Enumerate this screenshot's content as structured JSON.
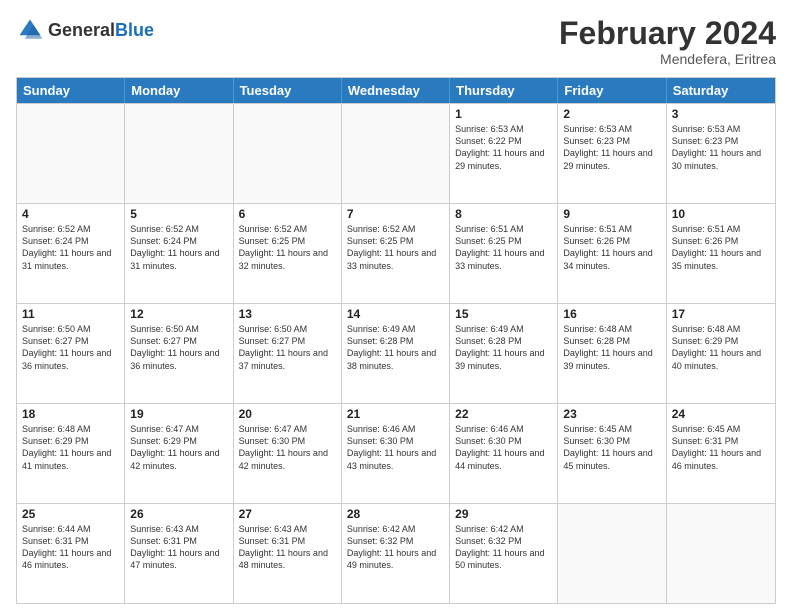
{
  "header": {
    "logo_general": "General",
    "logo_blue": "Blue",
    "month_year": "February 2024",
    "location": "Mendefera, Eritrea"
  },
  "days_of_week": [
    "Sunday",
    "Monday",
    "Tuesday",
    "Wednesday",
    "Thursday",
    "Friday",
    "Saturday"
  ],
  "weeks": [
    [
      {
        "day": "",
        "info": ""
      },
      {
        "day": "",
        "info": ""
      },
      {
        "day": "",
        "info": ""
      },
      {
        "day": "",
        "info": ""
      },
      {
        "day": "1",
        "info": "Sunrise: 6:53 AM\nSunset: 6:22 PM\nDaylight: 11 hours and 29 minutes."
      },
      {
        "day": "2",
        "info": "Sunrise: 6:53 AM\nSunset: 6:23 PM\nDaylight: 11 hours and 29 minutes."
      },
      {
        "day": "3",
        "info": "Sunrise: 6:53 AM\nSunset: 6:23 PM\nDaylight: 11 hours and 30 minutes."
      }
    ],
    [
      {
        "day": "4",
        "info": "Sunrise: 6:52 AM\nSunset: 6:24 PM\nDaylight: 11 hours and 31 minutes."
      },
      {
        "day": "5",
        "info": "Sunrise: 6:52 AM\nSunset: 6:24 PM\nDaylight: 11 hours and 31 minutes."
      },
      {
        "day": "6",
        "info": "Sunrise: 6:52 AM\nSunset: 6:25 PM\nDaylight: 11 hours and 32 minutes."
      },
      {
        "day": "7",
        "info": "Sunrise: 6:52 AM\nSunset: 6:25 PM\nDaylight: 11 hours and 33 minutes."
      },
      {
        "day": "8",
        "info": "Sunrise: 6:51 AM\nSunset: 6:25 PM\nDaylight: 11 hours and 33 minutes."
      },
      {
        "day": "9",
        "info": "Sunrise: 6:51 AM\nSunset: 6:26 PM\nDaylight: 11 hours and 34 minutes."
      },
      {
        "day": "10",
        "info": "Sunrise: 6:51 AM\nSunset: 6:26 PM\nDaylight: 11 hours and 35 minutes."
      }
    ],
    [
      {
        "day": "11",
        "info": "Sunrise: 6:50 AM\nSunset: 6:27 PM\nDaylight: 11 hours and 36 minutes."
      },
      {
        "day": "12",
        "info": "Sunrise: 6:50 AM\nSunset: 6:27 PM\nDaylight: 11 hours and 36 minutes."
      },
      {
        "day": "13",
        "info": "Sunrise: 6:50 AM\nSunset: 6:27 PM\nDaylight: 11 hours and 37 minutes."
      },
      {
        "day": "14",
        "info": "Sunrise: 6:49 AM\nSunset: 6:28 PM\nDaylight: 11 hours and 38 minutes."
      },
      {
        "day": "15",
        "info": "Sunrise: 6:49 AM\nSunset: 6:28 PM\nDaylight: 11 hours and 39 minutes."
      },
      {
        "day": "16",
        "info": "Sunrise: 6:48 AM\nSunset: 6:28 PM\nDaylight: 11 hours and 39 minutes."
      },
      {
        "day": "17",
        "info": "Sunrise: 6:48 AM\nSunset: 6:29 PM\nDaylight: 11 hours and 40 minutes."
      }
    ],
    [
      {
        "day": "18",
        "info": "Sunrise: 6:48 AM\nSunset: 6:29 PM\nDaylight: 11 hours and 41 minutes."
      },
      {
        "day": "19",
        "info": "Sunrise: 6:47 AM\nSunset: 6:29 PM\nDaylight: 11 hours and 42 minutes."
      },
      {
        "day": "20",
        "info": "Sunrise: 6:47 AM\nSunset: 6:30 PM\nDaylight: 11 hours and 42 minutes."
      },
      {
        "day": "21",
        "info": "Sunrise: 6:46 AM\nSunset: 6:30 PM\nDaylight: 11 hours and 43 minutes."
      },
      {
        "day": "22",
        "info": "Sunrise: 6:46 AM\nSunset: 6:30 PM\nDaylight: 11 hours and 44 minutes."
      },
      {
        "day": "23",
        "info": "Sunrise: 6:45 AM\nSunset: 6:30 PM\nDaylight: 11 hours and 45 minutes."
      },
      {
        "day": "24",
        "info": "Sunrise: 6:45 AM\nSunset: 6:31 PM\nDaylight: 11 hours and 46 minutes."
      }
    ],
    [
      {
        "day": "25",
        "info": "Sunrise: 6:44 AM\nSunset: 6:31 PM\nDaylight: 11 hours and 46 minutes."
      },
      {
        "day": "26",
        "info": "Sunrise: 6:43 AM\nSunset: 6:31 PM\nDaylight: 11 hours and 47 minutes."
      },
      {
        "day": "27",
        "info": "Sunrise: 6:43 AM\nSunset: 6:31 PM\nDaylight: 11 hours and 48 minutes."
      },
      {
        "day": "28",
        "info": "Sunrise: 6:42 AM\nSunset: 6:32 PM\nDaylight: 11 hours and 49 minutes."
      },
      {
        "day": "29",
        "info": "Sunrise: 6:42 AM\nSunset: 6:32 PM\nDaylight: 11 hours and 50 minutes."
      },
      {
        "day": "",
        "info": ""
      },
      {
        "day": "",
        "info": ""
      }
    ]
  ]
}
